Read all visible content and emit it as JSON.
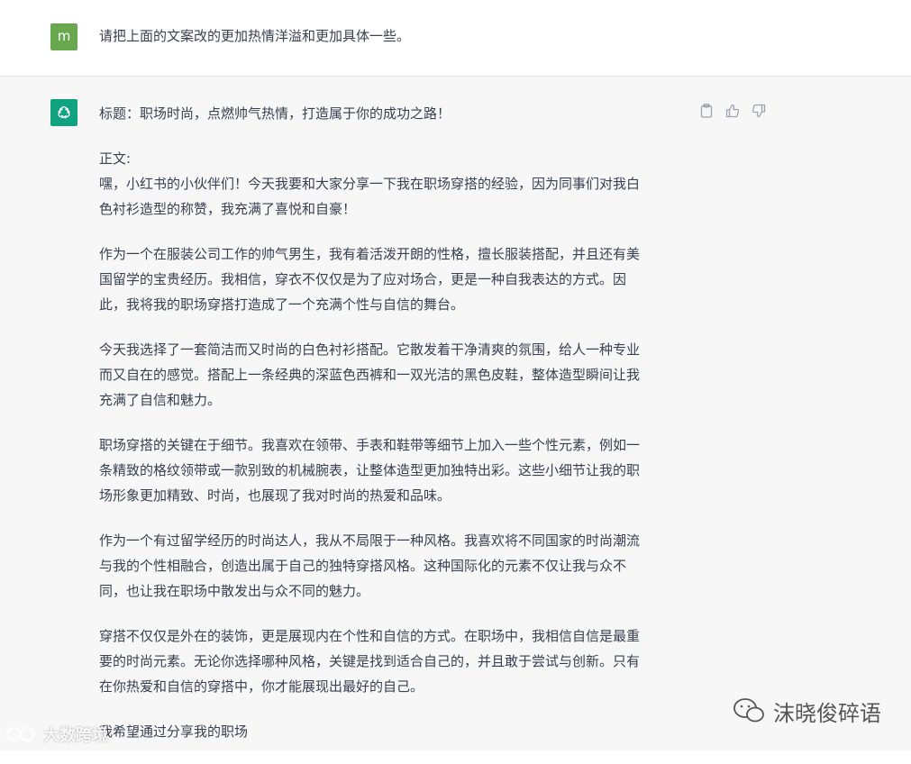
{
  "user_message": {
    "avatar_letter": "m",
    "text": "请把上面的文案改的更加热情洋溢和更加具体一些。"
  },
  "assistant_message": {
    "paragraphs": [
      [
        "标题：职场时尚，点燃帅气热情，打造属于你的成功之路！"
      ],
      [
        "正文:",
        "嘿，小红书的小伙伴们！今天我要和大家分享一下我在职场穿搭的经验，因为同事们对我白",
        "色衬衫造型的称赞，我充满了喜悦和自豪！"
      ],
      [
        "作为一个在服装公司工作的帅气男生，我有着活泼开朗的性格，擅长服装搭配，并且还有美",
        "国留学的宝贵经历。我相信，穿衣不仅仅是为了应对场合，更是一种自我表达的方式。因",
        "此，我将我的职场穿搭打造成了一个充满个性与自信的舞台。"
      ],
      [
        "今天我选择了一套简洁而又时尚的白色衬衫搭配。它散发着干净清爽的氛围，给人一种专业",
        "而又自在的感觉。搭配上一条经典的深蓝色西裤和一双光洁的黑色皮鞋，整体造型瞬间让我",
        "充满了自信和魅力。"
      ],
      [
        "职场穿搭的关键在于细节。我喜欢在领带、手表和鞋带等细节上加入一些个性元素，例如一",
        "条精致的格纹领带或一款别致的机械腕表，让整体造型更加独特出彩。这些小细节让我的职",
        "场形象更加精致、时尚，也展现了我对时尚的热爱和品味。"
      ],
      [
        "作为一个有过留学经历的时尚达人，我从不局限于一种风格。我喜欢将不同国家的时尚潮流",
        "与我的个性相融合，创造出属于自己的独特穿搭风格。这种国际化的元素不仅让我与众不",
        "同，也让我在职场中散发出与众不同的魅力。"
      ],
      [
        "穿搭不仅仅是外在的装饰，更是展现内在个性和自信的方式。在职场中，我相信自信是最重",
        "要的时尚元素。无论你选择哪种风格，关键是找到适合自己的，并且敢于尝试与创新。只有",
        "在你热爱和自信的穿搭中，你才能展现出最好的自己。"
      ],
      [
        "我希望通过分享我的职场"
      ]
    ]
  },
  "actions": {
    "copy_icon": "clipboard-icon",
    "like_icon": "thumbs-up-icon",
    "dislike_icon": "thumbs-down-icon"
  },
  "watermarks": {
    "left": "大数跨境",
    "right": "沫晓俊碎语"
  },
  "colors": {
    "user_avatar": "#6aa84f",
    "bot_avatar": "#10a37f",
    "assistant_bg": "#f7f7f8"
  }
}
